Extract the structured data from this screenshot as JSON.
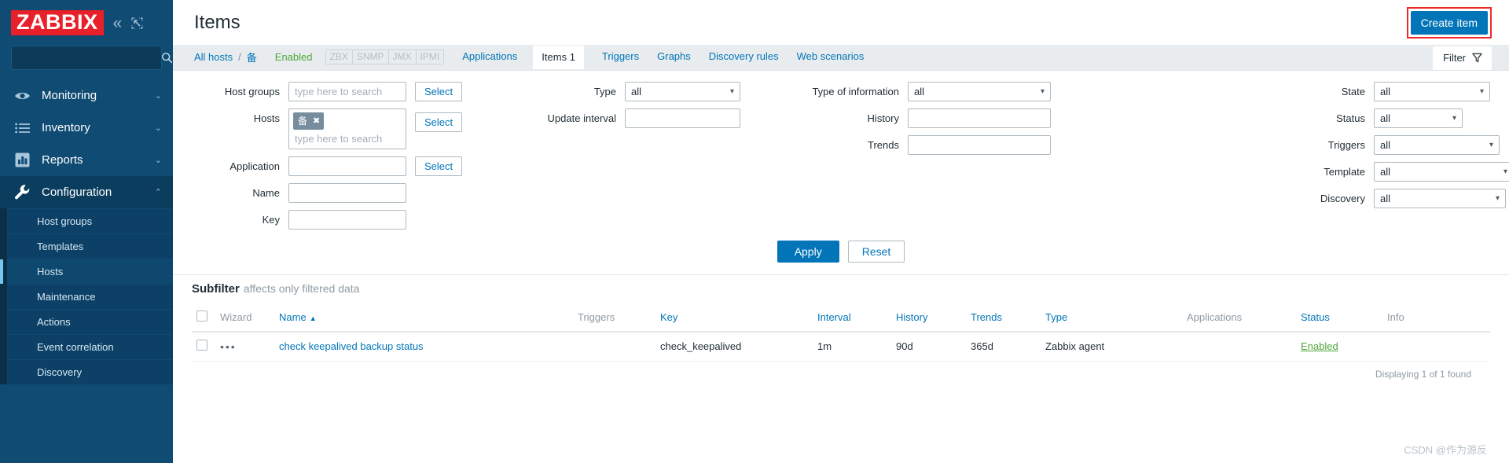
{
  "sidebar": {
    "logo_text": "ZABBIX",
    "collapse_icon": "chevron-double-left-icon",
    "expand_icon": "expand-icon",
    "search": {
      "value": "",
      "placeholder": ""
    },
    "nav": [
      {
        "label": "Monitoring",
        "icon": "eye-icon",
        "chevron": "⌄",
        "active": false
      },
      {
        "label": "Inventory",
        "icon": "list-icon",
        "chevron": "⌄",
        "active": false
      },
      {
        "label": "Reports",
        "icon": "bar-chart-icon",
        "chevron": "⌄",
        "active": false
      },
      {
        "label": "Configuration",
        "icon": "wrench-icon",
        "chevron": "⌃",
        "active": true
      }
    ],
    "submenu": [
      {
        "label": "Host groups",
        "selected": false
      },
      {
        "label": "Templates",
        "selected": false
      },
      {
        "label": "Hosts",
        "selected": true
      },
      {
        "label": "Maintenance",
        "selected": false
      },
      {
        "label": "Actions",
        "selected": false
      },
      {
        "label": "Event correlation",
        "selected": false
      },
      {
        "label": "Discovery",
        "selected": false
      }
    ]
  },
  "header": {
    "title": "Items",
    "create_button": "Create item"
  },
  "tabs": {
    "breadcrumb_all_hosts": "All hosts",
    "breadcrumb_sep": "/",
    "breadcrumb_host": "备",
    "status": "Enabled",
    "protocols": [
      "ZBX",
      "SNMP",
      "JMX",
      "IPMI"
    ],
    "links": [
      {
        "label": "Applications",
        "selected": false
      },
      {
        "label": "Items 1",
        "selected": true
      },
      {
        "label": "Triggers",
        "selected": false
      },
      {
        "label": "Graphs",
        "selected": false
      },
      {
        "label": "Discovery rules",
        "selected": false
      },
      {
        "label": "Web scenarios",
        "selected": false
      }
    ],
    "filter_tab": "Filter",
    "filter_icon": "funnel-icon"
  },
  "filter": {
    "col1": [
      {
        "label": "Host groups",
        "type": "input",
        "value": "",
        "placeholder": "type here to search",
        "button": "Select"
      },
      {
        "label": "Hosts",
        "type": "multiselect",
        "chip": "备",
        "chip_remove": "✖",
        "value": "",
        "placeholder": "type here to search",
        "button": "Select"
      },
      {
        "label": "Application",
        "type": "input",
        "value": "",
        "placeholder": "",
        "button": "Select"
      },
      {
        "label": "Name",
        "type": "input",
        "value": "",
        "placeholder": ""
      },
      {
        "label": "Key",
        "type": "input",
        "value": "",
        "placeholder": ""
      }
    ],
    "col2": [
      {
        "label": "Type",
        "type": "select",
        "value": "all"
      },
      {
        "label": "Update interval",
        "type": "input",
        "value": "",
        "placeholder": ""
      }
    ],
    "col3": [
      {
        "label": "Type of information",
        "type": "select",
        "value": "all"
      },
      {
        "label": "History",
        "type": "input",
        "value": "",
        "placeholder": ""
      },
      {
        "label": "Trends",
        "type": "input",
        "value": "",
        "placeholder": ""
      }
    ],
    "col4": [
      {
        "label": "State",
        "type": "select",
        "value": "all"
      },
      {
        "label": "Status",
        "type": "select",
        "value": "all"
      },
      {
        "label": "Triggers",
        "type": "select",
        "value": "all"
      },
      {
        "label": "Template",
        "type": "select",
        "value": "all"
      },
      {
        "label": "Discovery",
        "type": "select",
        "value": "all"
      }
    ],
    "apply_button": "Apply",
    "reset_button": "Reset"
  },
  "subfilter": {
    "title": "Subfilter",
    "note": "affects only filtered data"
  },
  "table": {
    "columns": [
      {
        "label": "",
        "type": "checkbox"
      },
      {
        "label": "Wizard",
        "muted": true
      },
      {
        "label": "Name",
        "sort": "▲",
        "muted": false
      },
      {
        "label": "Triggers",
        "muted": true
      },
      {
        "label": "Key",
        "muted": false
      },
      {
        "label": "Interval",
        "muted": false
      },
      {
        "label": "History",
        "muted": false
      },
      {
        "label": "Trends",
        "muted": false
      },
      {
        "label": "Type",
        "muted": false
      },
      {
        "label": "Applications",
        "muted": true
      },
      {
        "label": "Status",
        "muted": false
      },
      {
        "label": "Info",
        "muted": true
      }
    ],
    "rows": [
      {
        "wizard": "•••",
        "name": "check keepalived backup status",
        "triggers": "",
        "key": "check_keepalived",
        "interval": "1m",
        "history": "90d",
        "trends": "365d",
        "type": "Zabbix agent",
        "applications": "",
        "status": "Enabled",
        "info": ""
      }
    ],
    "footer": "Displaying 1 of 1 found"
  },
  "watermark": "CSDN @作为源反",
  "colors": {
    "sidebar_bg": "#0f4b73",
    "logo_red": "#e8202a",
    "accent_blue": "#0275b8",
    "enabled_green": "#4ea83c",
    "highlight_red": "#ee2b2b"
  }
}
